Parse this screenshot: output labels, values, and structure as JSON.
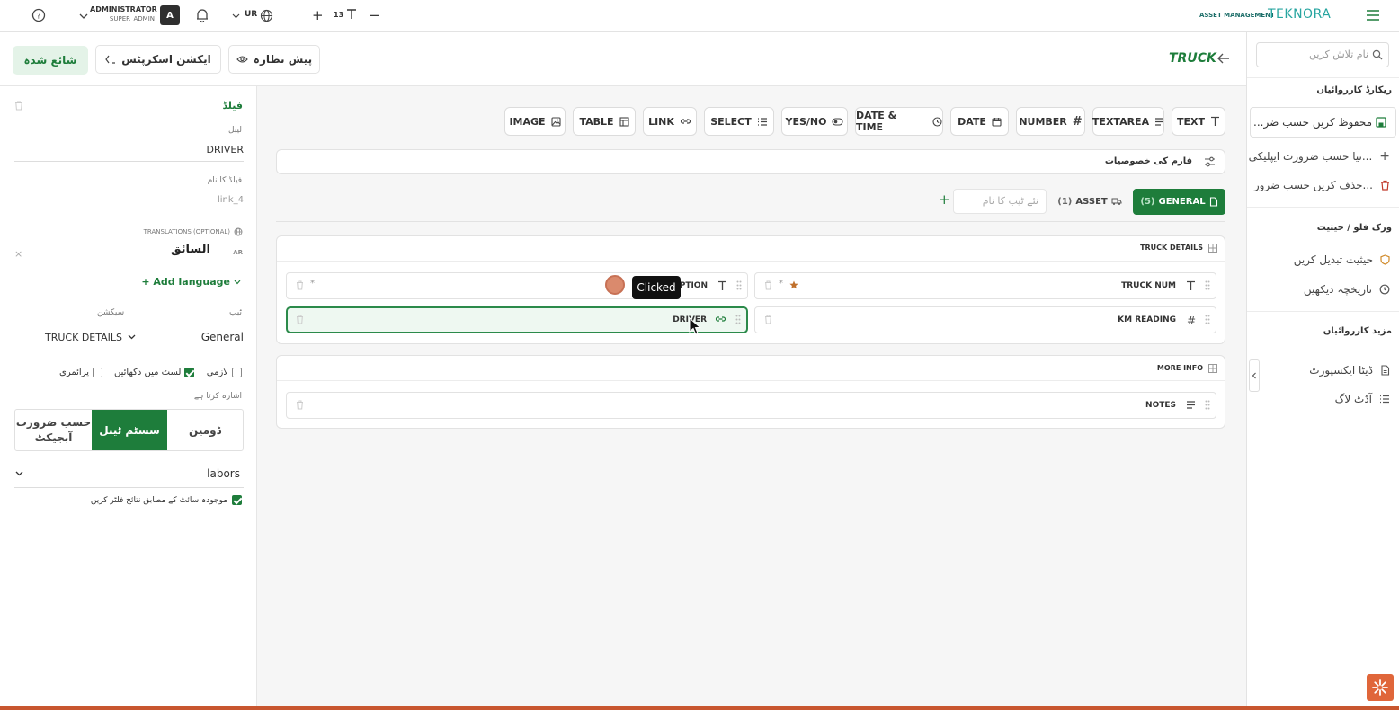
{
  "topbar": {
    "brand_small": "ASSET MANAGEMENT",
    "brand": "TEKNORA",
    "lang": "UR",
    "font_size": "13",
    "font_plus": "+",
    "font_minus": "−",
    "user_name": "ADMINISTRATOR",
    "user_role": "SUPER_ADMIN",
    "avatar_letter": "A"
  },
  "header": {
    "title": "TRUCK",
    "preview_label": "پیش نظارہ",
    "action_label": "ایکشن اسکرپٹس",
    "publish_label": "شائع شدہ"
  },
  "rightpanel": {
    "search_placeholder": "نام تلاش کریں",
    "section1_title": "ریکارڈ کارروائیاں",
    "item_save": "محفوظ کریں حسب ضر...",
    "item_new": "نیا حسب ضرورت ایپلیکی...",
    "item_delete": "حذف کریں حسب ضرور...",
    "section2_title": "ورک فلو / حیثیت",
    "item_status": "حیثیت تبدیل کریں",
    "item_history": "تاریخچہ دیکھیں",
    "section3_title": "مزید کارروائیاں",
    "item_export": "ڈیٹا ایکسپورٹ",
    "item_audit": "آڈٹ لاگ"
  },
  "types": [
    "TEXT",
    "TEXTAREA",
    "NUMBER",
    "DATE",
    "DATE & TIME",
    "YES/NO",
    "SELECT",
    "LINK",
    "TABLE",
    "IMAGE"
  ],
  "form": {
    "properties_label": "فارم کی خصوصیات",
    "tab_general": "GENERAL",
    "tab_general_count": "(5)",
    "tab_asset": "ASSET",
    "tab_asset_count": "(1)",
    "new_tab_placeholder": "نئے ٹیب کا نام",
    "add_tab": "+",
    "section1_title": "TRUCK DETAILS",
    "section2_title": "MORE INFO",
    "f_truck_num": "TRUCK NUM",
    "f_description": "DESCRIPTION",
    "f_km_reading": "KM READING",
    "f_driver": "DRIVER",
    "f_notes": "NOTES",
    "required_mark": "*",
    "tooltip": "Clicked"
  },
  "leftpanel": {
    "title": "فیلڈ",
    "label_caption": "لیبل",
    "label_value": "DRIVER",
    "name_caption": "فیلڈ کا نام",
    "name_value": "link_4",
    "translations_caption": "TRANSLATIONS (OPTIONAL)",
    "lang_code": "AR",
    "translation_value": "السائق",
    "add_language": "+ Add language",
    "tab_caption": "ٹیب",
    "section_caption": "سیکشن",
    "tab_value": "General",
    "section_value": "TRUCK DETAILS",
    "chk_required": "لازمی",
    "chk_list": "لسٹ میں دکھائیں",
    "chk_readonly": "پرائمری",
    "points_to": "اشارہ کرتا ہے",
    "seg_domain": "ڈومین",
    "seg_system": "سسٹم ٹیبل",
    "seg_custom": "حسب ضرورت آبجیکٹ",
    "select_value": "labors",
    "filter_label": "موجودہ سائٹ کے مطابق نتائج فلٹر کریں"
  },
  "colors": {
    "accent": "#1e7d3b",
    "accent_light": "#e8f5ec",
    "danger": "#c0392b",
    "brand_teal": "#27a5a0",
    "bottom_bar": "#c8562f"
  }
}
